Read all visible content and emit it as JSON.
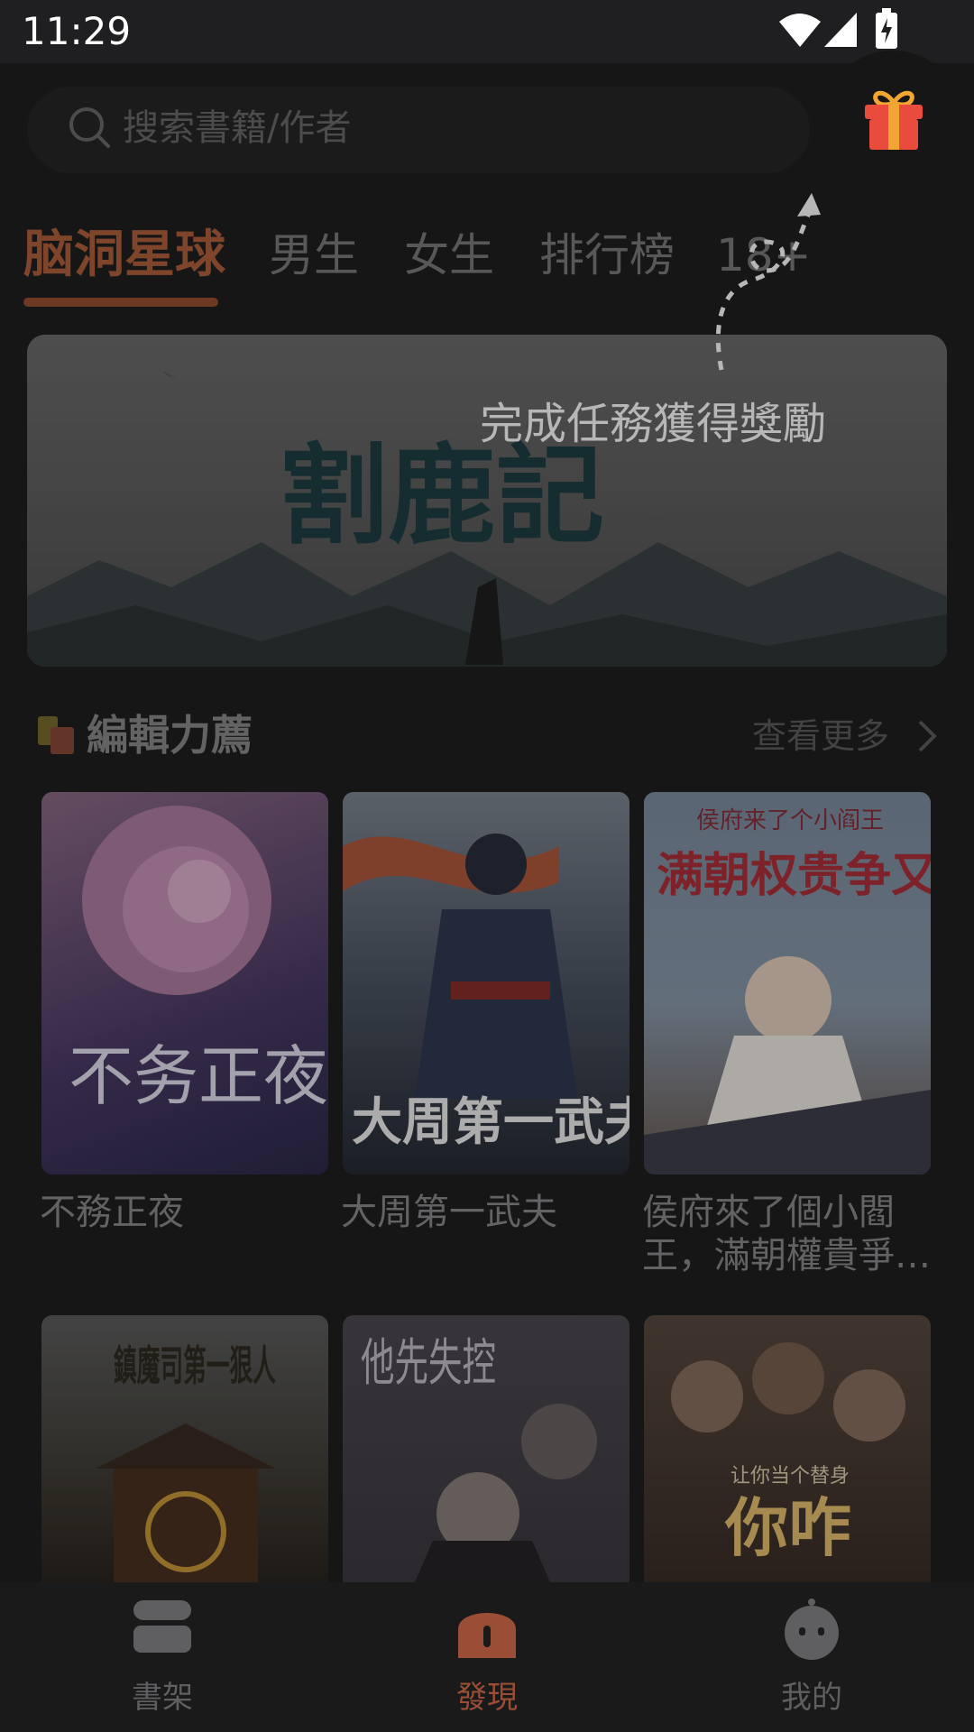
{
  "status": {
    "time": "11:29"
  },
  "search": {
    "placeholder": "搜索書籍/作者"
  },
  "tabs": [
    "脑洞星球",
    "男生",
    "女生",
    "排行榜",
    "18+"
  ],
  "tooltip": {
    "text": "完成任務獲得獎勵"
  },
  "section": {
    "title": "編輯力薦",
    "more": "查看更多"
  },
  "books": [
    {
      "title": "不務正夜",
      "cover_text": "不务正夜"
    },
    {
      "title": "大周第一武夫",
      "cover_text": "大周第一武夫"
    },
    {
      "title": "侯府來了個小閻王，滿朝權貴爭…",
      "cover_text": "满朝权贵争又抢",
      "cover_top": "侯府来了个小阎王"
    },
    {
      "cover_text": "鎮魔司第一狠人"
    },
    {
      "cover_text": "他先失控"
    },
    {
      "cover_text": "你咋",
      "cover_top": "让你当个替身"
    }
  ],
  "banner": {
    "art_text": "割鹿記"
  },
  "nav": [
    {
      "label": "書架",
      "icon": "bookshelf-icon",
      "active": false
    },
    {
      "label": "發現",
      "icon": "discover-icon",
      "active": true
    },
    {
      "label": "我的",
      "icon": "profile-icon",
      "active": false
    }
  ],
  "colors": {
    "accent": "#b0603d",
    "background": "#1f1f21"
  }
}
